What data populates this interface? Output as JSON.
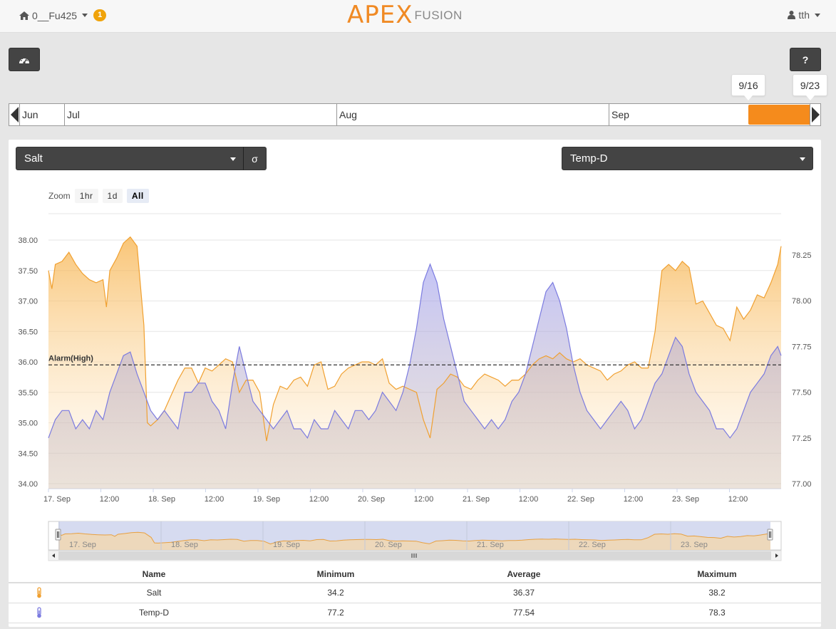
{
  "nav": {
    "home_label": "0__Fu425",
    "notification_count": "1",
    "logo_main": "APEX",
    "logo_sub": "FUSION",
    "user_label": "tth"
  },
  "toolbar": {
    "help_label": "?"
  },
  "date_range": {
    "start": "9/16",
    "end": "9/23"
  },
  "timeline": {
    "months": [
      "Jun",
      "Jul",
      "Aug",
      "Sep"
    ]
  },
  "selectors": {
    "left_probe": "Salt",
    "sigma_label": "σ",
    "right_probe": "Temp-D"
  },
  "zoom": {
    "label": "Zoom",
    "options": [
      "1hr",
      "1d",
      "All"
    ],
    "active": "All"
  },
  "chart_data": {
    "type": "line",
    "x_labels": [
      "17. Sep",
      "12:00",
      "18. Sep",
      "12:00",
      "19. Sep",
      "12:00",
      "20. Sep",
      "12:00",
      "21. Sep",
      "12:00",
      "22. Sep",
      "12:00",
      "23. Sep",
      "12:00"
    ],
    "left_axis": {
      "ticks": [
        "38.00",
        "37.50",
        "37.00",
        "36.50",
        "36.00",
        "35.50",
        "35.00",
        "34.50",
        "34.00"
      ],
      "range": [
        34.0,
        38.0
      ]
    },
    "right_axis": {
      "ticks": [
        "78.25",
        "78.00",
        "77.75",
        "77.50",
        "77.25",
        "77.00"
      ],
      "range": [
        77.0,
        78.3
      ]
    },
    "alarm": {
      "label": "Alarm(High)",
      "value": 35.95
    },
    "navigator_labels": [
      "17. Sep",
      "18. Sep",
      "19. Sep",
      "20. Sep",
      "21. Sep",
      "22. Sep",
      "23. Sep"
    ],
    "series": [
      {
        "name": "Salt",
        "color": "#f0a030",
        "axis": "left",
        "points": [
          [
            0,
            37.5
          ],
          [
            0.5,
            37.2
          ],
          [
            1,
            37.6
          ],
          [
            2,
            37.65
          ],
          [
            3,
            37.8
          ],
          [
            4,
            37.6
          ],
          [
            5,
            37.45
          ],
          [
            6,
            37.35
          ],
          [
            7,
            37.3
          ],
          [
            8,
            37.35
          ],
          [
            8.5,
            36.9
          ],
          [
            9,
            37.5
          ],
          [
            10,
            37.7
          ],
          [
            11,
            37.95
          ],
          [
            12,
            38.05
          ],
          [
            13,
            37.9
          ],
          [
            14,
            36.6
          ],
          [
            14.5,
            35.0
          ],
          [
            15,
            34.95
          ],
          [
            16,
            35.05
          ],
          [
            17,
            35.2
          ],
          [
            18,
            35.45
          ],
          [
            19,
            35.7
          ],
          [
            20,
            35.9
          ],
          [
            21,
            35.9
          ],
          [
            22,
            35.65
          ],
          [
            23,
            35.9
          ],
          [
            24,
            35.85
          ],
          [
            25,
            35.95
          ],
          [
            26,
            36.05
          ],
          [
            27,
            36.0
          ],
          [
            28,
            35.5
          ],
          [
            29,
            35.7
          ],
          [
            30,
            35.7
          ],
          [
            31,
            35.5
          ],
          [
            32,
            34.7
          ],
          [
            33,
            35.3
          ],
          [
            34,
            35.6
          ],
          [
            35,
            35.55
          ],
          [
            36,
            35.7
          ],
          [
            37,
            35.75
          ],
          [
            38,
            35.6
          ],
          [
            39,
            35.95
          ],
          [
            40,
            36.0
          ],
          [
            41,
            35.55
          ],
          [
            42,
            35.6
          ],
          [
            43,
            35.8
          ],
          [
            44,
            35.9
          ],
          [
            45,
            35.95
          ],
          [
            46,
            36.0
          ],
          [
            47,
            36.0
          ],
          [
            48,
            35.95
          ],
          [
            49,
            36.05
          ],
          [
            50,
            35.65
          ],
          [
            51,
            35.55
          ],
          [
            52,
            35.6
          ],
          [
            53,
            35.55
          ],
          [
            54,
            35.5
          ],
          [
            55,
            35.05
          ],
          [
            56,
            34.75
          ],
          [
            57,
            35.55
          ],
          [
            58,
            35.65
          ],
          [
            59,
            35.8
          ],
          [
            60,
            35.75
          ],
          [
            61,
            35.6
          ],
          [
            62,
            35.55
          ],
          [
            63,
            35.7
          ],
          [
            64,
            35.8
          ],
          [
            65,
            35.75
          ],
          [
            66,
            35.7
          ],
          [
            67,
            35.6
          ],
          [
            68,
            35.7
          ],
          [
            69,
            35.7
          ],
          [
            70,
            35.8
          ],
          [
            71,
            35.95
          ],
          [
            72,
            36.05
          ],
          [
            73,
            36.1
          ],
          [
            74,
            36.05
          ],
          [
            75,
            36.15
          ],
          [
            76,
            36.05
          ],
          [
            77,
            36.0
          ],
          [
            78,
            36.05
          ],
          [
            79,
            35.95
          ],
          [
            80,
            35.9
          ],
          [
            81,
            35.85
          ],
          [
            82,
            35.7
          ],
          [
            83,
            35.8
          ],
          [
            84,
            35.85
          ],
          [
            85,
            35.95
          ],
          [
            86,
            36.0
          ],
          [
            87,
            35.9
          ],
          [
            88,
            35.9
          ],
          [
            89,
            36.5
          ],
          [
            90,
            37.5
          ],
          [
            91,
            37.6
          ],
          [
            92,
            37.5
          ],
          [
            93,
            37.65
          ],
          [
            94,
            37.55
          ],
          [
            95,
            36.95
          ],
          [
            96,
            37.0
          ],
          [
            97,
            36.8
          ],
          [
            98,
            36.6
          ],
          [
            99,
            36.55
          ],
          [
            100,
            36.35
          ],
          [
            101,
            36.9
          ],
          [
            102,
            36.7
          ],
          [
            103,
            36.85
          ],
          [
            104,
            37.1
          ],
          [
            105,
            37.05
          ],
          [
            106,
            37.3
          ],
          [
            107,
            37.6
          ],
          [
            107.5,
            37.9
          ]
        ]
      },
      {
        "name": "Temp-D",
        "color": "#7b7be0",
        "axis": "right",
        "points": [
          [
            0,
            77.25
          ],
          [
            1,
            77.35
          ],
          [
            2,
            77.4
          ],
          [
            3,
            77.4
          ],
          [
            4,
            77.3
          ],
          [
            5,
            77.35
          ],
          [
            6,
            77.3
          ],
          [
            7,
            77.4
          ],
          [
            8,
            77.35
          ],
          [
            9,
            77.5
          ],
          [
            10,
            77.6
          ],
          [
            11,
            77.7
          ],
          [
            12,
            77.72
          ],
          [
            13,
            77.6
          ],
          [
            14,
            77.5
          ],
          [
            15,
            77.4
          ],
          [
            16,
            77.35
          ],
          [
            17,
            77.4
          ],
          [
            18,
            77.35
          ],
          [
            19,
            77.3
          ],
          [
            20,
            77.5
          ],
          [
            21,
            77.5
          ],
          [
            22,
            77.55
          ],
          [
            23,
            77.55
          ],
          [
            24,
            77.45
          ],
          [
            25,
            77.4
          ],
          [
            26,
            77.3
          ],
          [
            27,
            77.55
          ],
          [
            28,
            77.75
          ],
          [
            29,
            77.6
          ],
          [
            30,
            77.45
          ],
          [
            31,
            77.4
          ],
          [
            32,
            77.35
          ],
          [
            33,
            77.3
          ],
          [
            34,
            77.35
          ],
          [
            35,
            77.4
          ],
          [
            36,
            77.3
          ],
          [
            37,
            77.3
          ],
          [
            38,
            77.25
          ],
          [
            39,
            77.35
          ],
          [
            40,
            77.3
          ],
          [
            41,
            77.3
          ],
          [
            42,
            77.4
          ],
          [
            43,
            77.35
          ],
          [
            44,
            77.3
          ],
          [
            45,
            77.4
          ],
          [
            46,
            77.4
          ],
          [
            47,
            77.35
          ],
          [
            48,
            77.4
          ],
          [
            49,
            77.5
          ],
          [
            50,
            77.45
          ],
          [
            51,
            77.4
          ],
          [
            52,
            77.5
          ],
          [
            53,
            77.65
          ],
          [
            54,
            77.85
          ],
          [
            55,
            78.1
          ],
          [
            56,
            78.2
          ],
          [
            57,
            78.1
          ],
          [
            58,
            77.9
          ],
          [
            59,
            77.75
          ],
          [
            60,
            77.6
          ],
          [
            61,
            77.45
          ],
          [
            62,
            77.4
          ],
          [
            63,
            77.35
          ],
          [
            64,
            77.3
          ],
          [
            65,
            77.35
          ],
          [
            66,
            77.3
          ],
          [
            67,
            77.35
          ],
          [
            68,
            77.45
          ],
          [
            69,
            77.5
          ],
          [
            70,
            77.6
          ],
          [
            71,
            77.75
          ],
          [
            72,
            77.9
          ],
          [
            73,
            78.05
          ],
          [
            74,
            78.1
          ],
          [
            75,
            78.0
          ],
          [
            76,
            77.85
          ],
          [
            77,
            77.65
          ],
          [
            78,
            77.5
          ],
          [
            79,
            77.4
          ],
          [
            80,
            77.35
          ],
          [
            81,
            77.3
          ],
          [
            82,
            77.35
          ],
          [
            83,
            77.4
          ],
          [
            84,
            77.45
          ],
          [
            85,
            77.4
          ],
          [
            86,
            77.3
          ],
          [
            87,
            77.35
          ],
          [
            88,
            77.45
          ],
          [
            89,
            77.55
          ],
          [
            90,
            77.6
          ],
          [
            91,
            77.7
          ],
          [
            92,
            77.8
          ],
          [
            93,
            77.75
          ],
          [
            94,
            77.6
          ],
          [
            95,
            77.5
          ],
          [
            96,
            77.45
          ],
          [
            97,
            77.4
          ],
          [
            98,
            77.3
          ],
          [
            99,
            77.3
          ],
          [
            100,
            77.25
          ],
          [
            101,
            77.3
          ],
          [
            102,
            77.4
          ],
          [
            103,
            77.5
          ],
          [
            104,
            77.55
          ],
          [
            105,
            77.6
          ],
          [
            106,
            77.7
          ],
          [
            107,
            77.75
          ],
          [
            107.5,
            77.7
          ]
        ]
      }
    ]
  },
  "stats": {
    "headers": {
      "name": "Name",
      "min": "Minimum",
      "avg": "Average",
      "max": "Maximum"
    },
    "rows": [
      {
        "name": "Salt",
        "min": "34.2",
        "avg": "36.37",
        "max": "38.2",
        "color": "#f0a030"
      },
      {
        "name": "Temp-D",
        "min": "77.2",
        "avg": "77.54",
        "max": "78.3",
        "color": "#7b7be0"
      }
    ]
  }
}
